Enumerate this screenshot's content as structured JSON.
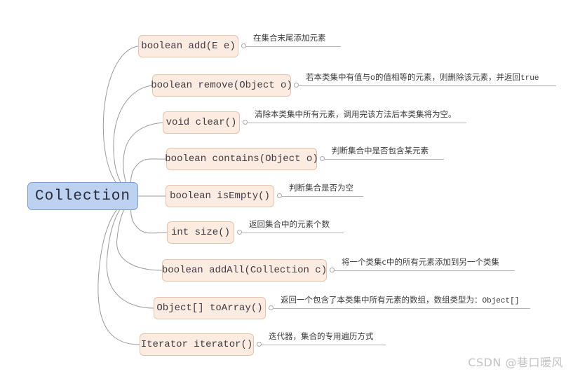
{
  "diagram": {
    "title": "Collection",
    "watermark": "CSDN @巷口暖风",
    "colors": {
      "root_fill": "#bcd2f0",
      "root_border": "#7a9ed0",
      "node_fill": "#fcebe0",
      "node_border": "#e8c3ab",
      "link": "#9a9a9a",
      "background": "#ffffff"
    },
    "root": {
      "label": "Collection"
    },
    "branches": [
      {
        "id": "add",
        "label": "boolean add(E e)",
        "description": "在集合末尾添加元素",
        "desc_suffix": ""
      },
      {
        "id": "remove",
        "label": "boolean remove(Object o)",
        "description": "若本类集中有值与o的值相等的元素，则删除该元素，并返回",
        "desc_suffix": "true"
      },
      {
        "id": "clear",
        "label": "void clear()",
        "description": "清除本类集中所有元素，调用完该方法后本类集将为空。",
        "desc_suffix": ""
      },
      {
        "id": "contains",
        "label": "boolean contains(Object o)",
        "description": "判断集合中是否包含某元素",
        "desc_suffix": ""
      },
      {
        "id": "isEmpty",
        "label": "boolean isEmpty()",
        "description": "判断集合是否为空",
        "desc_suffix": ""
      },
      {
        "id": "size",
        "label": "int size()",
        "description": "返回集合中的元素个数",
        "desc_suffix": ""
      },
      {
        "id": "addAll",
        "label": "boolean addAll(Collection c)",
        "description": "将一个类集c中的所有元素添加到另一个类集",
        "desc_suffix": ""
      },
      {
        "id": "toArray",
        "label": "Object[] toArray()",
        "description": "返回一个包含了本类集中所有元素的数组，数组类型为：",
        "desc_suffix": "Object[]"
      },
      {
        "id": "iterator",
        "label": "Iterator iterator()",
        "description": "迭代器，集合的专用遍历方式",
        "desc_suffix": ""
      }
    ]
  }
}
